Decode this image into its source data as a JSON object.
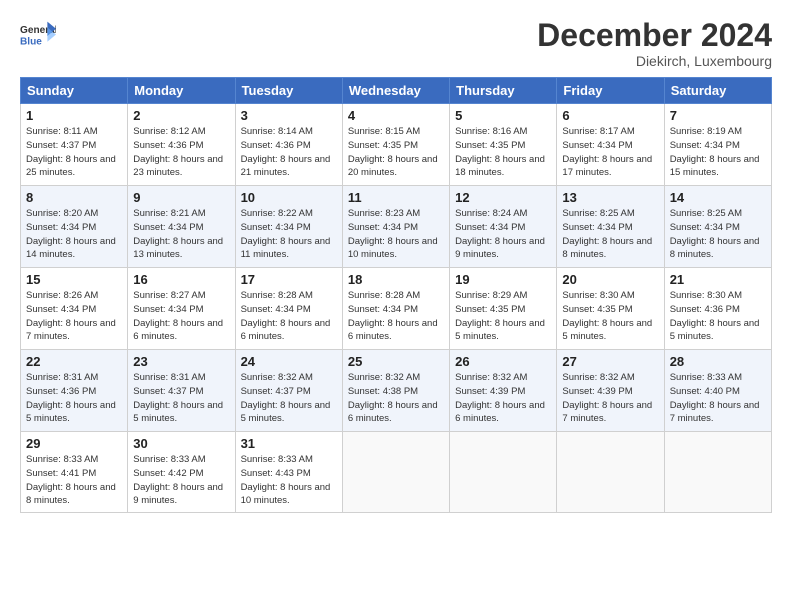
{
  "header": {
    "logo_general": "General",
    "logo_blue": "Blue",
    "month_title": "December 2024",
    "subtitle": "Diekirch, Luxembourg"
  },
  "days_of_week": [
    "Sunday",
    "Monday",
    "Tuesday",
    "Wednesday",
    "Thursday",
    "Friday",
    "Saturday"
  ],
  "weeks": [
    [
      {
        "day": "1",
        "sunrise": "8:11 AM",
        "sunset": "4:37 PM",
        "daylight": "8 hours and 25 minutes."
      },
      {
        "day": "2",
        "sunrise": "8:12 AM",
        "sunset": "4:36 PM",
        "daylight": "8 hours and 23 minutes."
      },
      {
        "day": "3",
        "sunrise": "8:14 AM",
        "sunset": "4:36 PM",
        "daylight": "8 hours and 21 minutes."
      },
      {
        "day": "4",
        "sunrise": "8:15 AM",
        "sunset": "4:35 PM",
        "daylight": "8 hours and 20 minutes."
      },
      {
        "day": "5",
        "sunrise": "8:16 AM",
        "sunset": "4:35 PM",
        "daylight": "8 hours and 18 minutes."
      },
      {
        "day": "6",
        "sunrise": "8:17 AM",
        "sunset": "4:34 PM",
        "daylight": "8 hours and 17 minutes."
      },
      {
        "day": "7",
        "sunrise": "8:19 AM",
        "sunset": "4:34 PM",
        "daylight": "8 hours and 15 minutes."
      }
    ],
    [
      {
        "day": "8",
        "sunrise": "8:20 AM",
        "sunset": "4:34 PM",
        "daylight": "8 hours and 14 minutes."
      },
      {
        "day": "9",
        "sunrise": "8:21 AM",
        "sunset": "4:34 PM",
        "daylight": "8 hours and 13 minutes."
      },
      {
        "day": "10",
        "sunrise": "8:22 AM",
        "sunset": "4:34 PM",
        "daylight": "8 hours and 11 minutes."
      },
      {
        "day": "11",
        "sunrise": "8:23 AM",
        "sunset": "4:34 PM",
        "daylight": "8 hours and 10 minutes."
      },
      {
        "day": "12",
        "sunrise": "8:24 AM",
        "sunset": "4:34 PM",
        "daylight": "8 hours and 9 minutes."
      },
      {
        "day": "13",
        "sunrise": "8:25 AM",
        "sunset": "4:34 PM",
        "daylight": "8 hours and 8 minutes."
      },
      {
        "day": "14",
        "sunrise": "8:25 AM",
        "sunset": "4:34 PM",
        "daylight": "8 hours and 8 minutes."
      }
    ],
    [
      {
        "day": "15",
        "sunrise": "8:26 AM",
        "sunset": "4:34 PM",
        "daylight": "8 hours and 7 minutes."
      },
      {
        "day": "16",
        "sunrise": "8:27 AM",
        "sunset": "4:34 PM",
        "daylight": "8 hours and 6 minutes."
      },
      {
        "day": "17",
        "sunrise": "8:28 AM",
        "sunset": "4:34 PM",
        "daylight": "8 hours and 6 minutes."
      },
      {
        "day": "18",
        "sunrise": "8:28 AM",
        "sunset": "4:34 PM",
        "daylight": "8 hours and 6 minutes."
      },
      {
        "day": "19",
        "sunrise": "8:29 AM",
        "sunset": "4:35 PM",
        "daylight": "8 hours and 5 minutes."
      },
      {
        "day": "20",
        "sunrise": "8:30 AM",
        "sunset": "4:35 PM",
        "daylight": "8 hours and 5 minutes."
      },
      {
        "day": "21",
        "sunrise": "8:30 AM",
        "sunset": "4:36 PM",
        "daylight": "8 hours and 5 minutes."
      }
    ],
    [
      {
        "day": "22",
        "sunrise": "8:31 AM",
        "sunset": "4:36 PM",
        "daylight": "8 hours and 5 minutes."
      },
      {
        "day": "23",
        "sunrise": "8:31 AM",
        "sunset": "4:37 PM",
        "daylight": "8 hours and 5 minutes."
      },
      {
        "day": "24",
        "sunrise": "8:32 AM",
        "sunset": "4:37 PM",
        "daylight": "8 hours and 5 minutes."
      },
      {
        "day": "25",
        "sunrise": "8:32 AM",
        "sunset": "4:38 PM",
        "daylight": "8 hours and 6 minutes."
      },
      {
        "day": "26",
        "sunrise": "8:32 AM",
        "sunset": "4:39 PM",
        "daylight": "8 hours and 6 minutes."
      },
      {
        "day": "27",
        "sunrise": "8:32 AM",
        "sunset": "4:39 PM",
        "daylight": "8 hours and 7 minutes."
      },
      {
        "day": "28",
        "sunrise": "8:33 AM",
        "sunset": "4:40 PM",
        "daylight": "8 hours and 7 minutes."
      }
    ],
    [
      {
        "day": "29",
        "sunrise": "8:33 AM",
        "sunset": "4:41 PM",
        "daylight": "8 hours and 8 minutes."
      },
      {
        "day": "30",
        "sunrise": "8:33 AM",
        "sunset": "4:42 PM",
        "daylight": "8 hours and 9 minutes."
      },
      {
        "day": "31",
        "sunrise": "8:33 AM",
        "sunset": "4:43 PM",
        "daylight": "8 hours and 10 minutes."
      },
      null,
      null,
      null,
      null
    ]
  ]
}
